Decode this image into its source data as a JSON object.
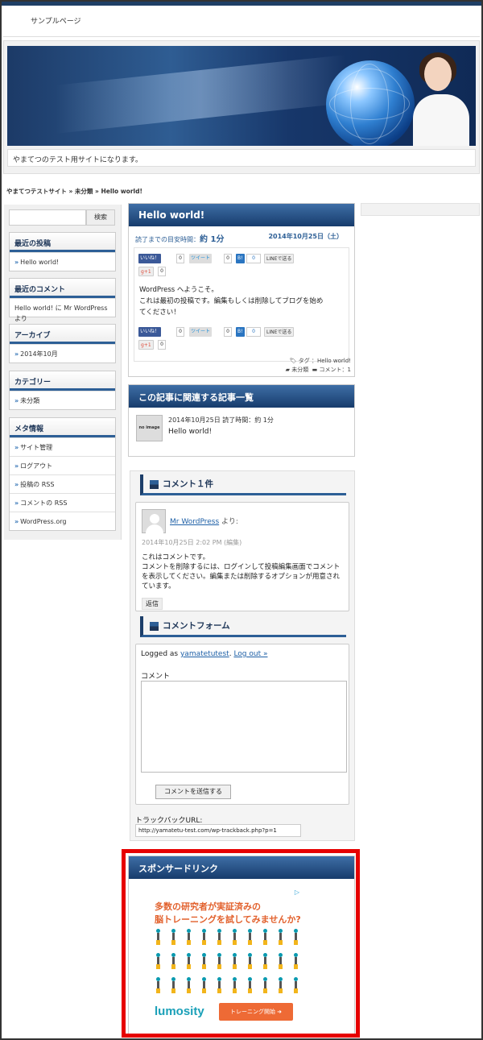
{
  "nav": {
    "sample_page": "サンプルページ"
  },
  "site": {
    "tagline": "やまてつのテスト用サイトになります。"
  },
  "breadcrumb": "やまてつテストサイト » 未分類 » Hello world!",
  "sidebar": {
    "search_button": "検索",
    "widgets": [
      {
        "title": "最近の投稿",
        "items": [
          "Hello world!"
        ]
      },
      {
        "title": "最近のコメント",
        "items": [
          "Hello world! に Mr WordPress より"
        ]
      },
      {
        "title": "アーカイブ",
        "items": [
          "2014年10月"
        ]
      },
      {
        "title": "カテゴリー",
        "items": [
          "未分類"
        ]
      },
      {
        "title": "メタ情報",
        "items": [
          "サイト管理",
          "ログアウト",
          "投稿の RSS",
          "コメントの RSS",
          "WordPress.org"
        ]
      }
    ]
  },
  "post": {
    "title": "Hello world!",
    "read_time_label": "読了までの目安時間：",
    "read_time_value": "約 1分",
    "date": "2014年10月25日（土）",
    "share": {
      "like": "いいね！",
      "tweet": "ツイート",
      "hatena": "B!",
      "line": "LINEで送る",
      "gplus": "g+1",
      "count": "0"
    },
    "body": [
      "WordPress へようこそ。",
      "これは最初の投稿です。編集もしくは削除してブログを始めてください！"
    ],
    "tag_label": "タグ ：Hello world!",
    "category": "未分類",
    "comment_count": "コメント：1"
  },
  "related": {
    "title": "この記事に関連する記事一覧",
    "thumb": "no image",
    "meta": "2014年10月25日   読了時間：約 1分",
    "item_title": "Hello world!"
  },
  "comments": {
    "heading": "コメント１件",
    "author": "Mr WordPress",
    "author_suffix": "より:",
    "date": "2014年10月25日 2:02 PM",
    "edit": "(編集)",
    "text": [
      "これはコメントです。",
      "コメントを削除するには、ログインして投稿編集画面でコメントを表示してください。編集または削除するオプションが用意されています。"
    ],
    "reply": "返信"
  },
  "form": {
    "heading": "コメントフォーム",
    "logged_as": "Logged as",
    "user": "yamatetutest",
    "logout": "Log out »",
    "comment_label": "コメント",
    "submit": "コメントを送信する",
    "trackback_label": "トラックバックURL:",
    "trackback_url": "http://yamatetu-test.com/wp-trackback.php?p=1"
  },
  "sponsor": {
    "title": "スポンサードリンク",
    "ad_line1": "多数の研究者が実証済みの",
    "ad_line2": "脳トレーニングを試してみませんか?",
    "brand": "lumosity",
    "cta": "トレーニング開始 ➜"
  },
  "colors": {
    "header_blue": "#1f3f66",
    "accent": "#2d5f96",
    "highlight_red": "#e60000",
    "cta_orange": "#ee6a35"
  }
}
